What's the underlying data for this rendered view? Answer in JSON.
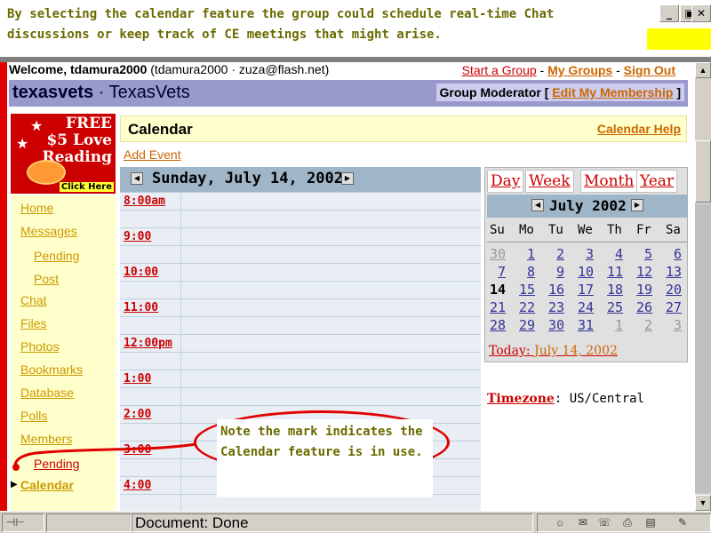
{
  "annotation_top": "By selecting the calendar feature the group could schedule real-time Chat discussions or keep track of CE meetings that might arise.",
  "window_buttons": {
    "minimize": "_",
    "maximize": "▣",
    "close": "✕"
  },
  "welcome": {
    "greeting": "Welcome, tdamura2000",
    "account": "(tdamura2000 · zuza@flash.net)",
    "start_group": "Start a Group",
    "sep1": " - ",
    "my_groups": "My Groups",
    "sep2": " - ",
    "sign_out": "Sign Out"
  },
  "group": {
    "short_name": "texasvets",
    "sep": " · ",
    "long_name": "TexasVets",
    "moderator_label": "Group Moderator [",
    "edit_membership": "Edit My Membership",
    "moderator_close": "]"
  },
  "ad": {
    "line1": "FREE",
    "line2": "$5 Love",
    "line3": "Reading",
    "click": "Click Here"
  },
  "nav": {
    "home": "Home",
    "messages": "Messages",
    "pending1": "Pending",
    "post": "Post",
    "chat": "Chat",
    "files": "Files",
    "photos": "Photos",
    "bookmarks": "Bookmarks",
    "database": "Database",
    "polls": "Polls",
    "members": "Members",
    "pending2": "Pending",
    "calendar": "Calendar"
  },
  "calendar": {
    "title": "Calendar",
    "help": "Calendar Help",
    "add_event": "Add Event",
    "day_title": "Sunday, July 14, 2002",
    "times": [
      "8:00am",
      "9:00",
      "10:00",
      "11:00",
      "12:00pm",
      "1:00",
      "2:00",
      "3:00",
      "4:00"
    ]
  },
  "views": {
    "day": "Day",
    "week": "Week",
    "month": "Month",
    "year": "Year"
  },
  "mini": {
    "title": "July 2002",
    "dows": [
      "Su",
      "Mo",
      "Tu",
      "We",
      "Th",
      "Fr",
      "Sa"
    ],
    "weeks": [
      [
        "30",
        "1",
        "2",
        "3",
        "4",
        "5",
        "6"
      ],
      [
        "7",
        "8",
        "9",
        "10",
        "11",
        "12",
        "13"
      ],
      [
        "14",
        "15",
        "16",
        "17",
        "18",
        "19",
        "20"
      ],
      [
        "21",
        "22",
        "23",
        "24",
        "25",
        "26",
        "27"
      ],
      [
        "28",
        "29",
        "30",
        "31",
        "1",
        "2",
        "3"
      ]
    ],
    "today_label": "Today:",
    "today_date": "July 14, 2002"
  },
  "timezone": {
    "label": "Timezone",
    "value": ": US/Central"
  },
  "annotation_bubble": "Note the mark indicates the Calendar feature is in use.",
  "status": {
    "text": "Document: Done"
  },
  "colors": {
    "accent_red": "#cc0000",
    "accent_orange": "#cc6600",
    "header_purple": "#9999cc",
    "nav_bg": "#ffffcc",
    "cal_blue": "#9fb6c8"
  }
}
